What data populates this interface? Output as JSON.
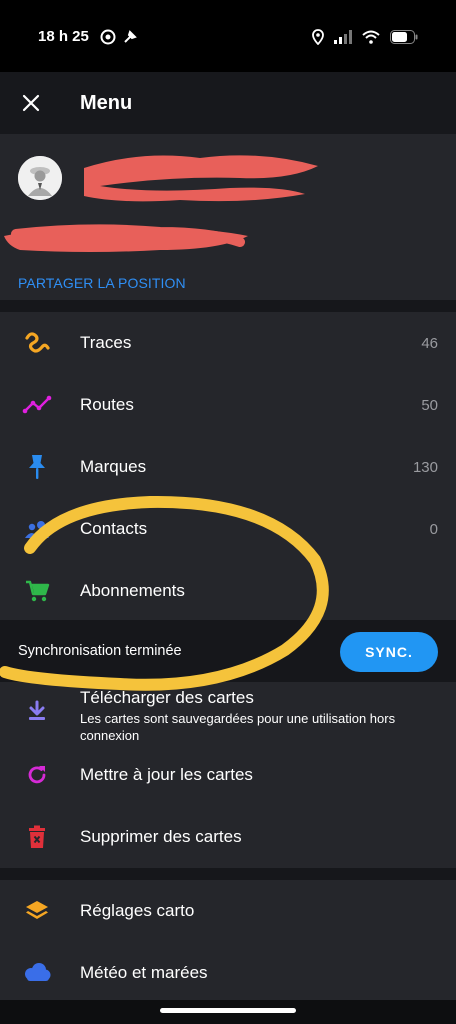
{
  "status_bar": {
    "time": "18 h 25"
  },
  "header": {
    "title": "Menu"
  },
  "profile": {
    "share_label": "PARTAGER LA POSITION"
  },
  "menu_items": [
    {
      "label": "Traces",
      "count": "46"
    },
    {
      "label": "Routes",
      "count": "50"
    },
    {
      "label": "Marques",
      "count": "130"
    },
    {
      "label": "Contacts",
      "count": "0"
    },
    {
      "label": "Abonnements"
    }
  ],
  "sync": {
    "status_text": "Synchronisation terminée",
    "button_label": "SYNC."
  },
  "map_items": [
    {
      "label": "Télécharger des cartes",
      "sublabel": "Les cartes sont sauvegardées pour une utilisation hors connexion"
    },
    {
      "label": "Mettre à jour les cartes"
    },
    {
      "label": "Supprimer des cartes"
    }
  ],
  "settings_items": [
    {
      "label": "Réglages carto"
    },
    {
      "label": "Météo et marées"
    }
  ],
  "colors": {
    "accent_blue": "#2196f3",
    "link_blue": "#2f8ff5",
    "traces_orange": "#f5a623",
    "routes_magenta": "#e020e0",
    "marques_blue": "#2a8cf0",
    "contacts_blue": "#3b6fe0",
    "abonnements_green": "#2fb84a",
    "download_purple": "#8a7cf2",
    "update_magenta": "#d62ad6",
    "delete_red": "#e0303a",
    "layers_orange": "#f5a623",
    "weather_blue": "#3a6ee8",
    "annotation_yellow": "#f5c33b",
    "redaction_red": "#e8605a"
  }
}
